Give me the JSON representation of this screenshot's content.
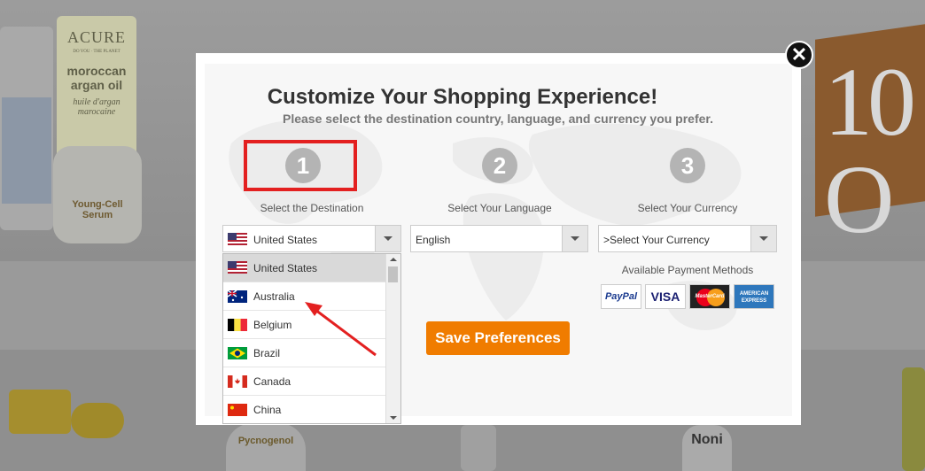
{
  "background": {
    "acure_brand": "ACURE",
    "acure_tagline": "DO YOU · THE PLANET",
    "acure_product": "moroccan argan oil",
    "acure_product_fr": "huile d'argan marocaine",
    "young_cell": "Young-Cell Serum",
    "pycnogenol": "Pycnogenol",
    "noni": "Noni",
    "promo_text": "10 O"
  },
  "modal": {
    "title": "Customize Your Shopping Experience!",
    "subtitle": "Please select the destination country, language, and currency you prefer.",
    "close_glyph": "✕",
    "steps": [
      {
        "number": "1",
        "label": "Select the Destination"
      },
      {
        "number": "2",
        "label": "Select Your Language"
      },
      {
        "number": "3",
        "label": "Select Your Currency"
      }
    ],
    "destination_select": {
      "value": "United States"
    },
    "language_select": {
      "value": "English"
    },
    "currency_select": {
      "value": ">Select Your Currency"
    },
    "country_options": [
      {
        "label": "United States",
        "flag": "us-flag-icon",
        "selected": true
      },
      {
        "label": "Australia",
        "flag": "australia-flag-icon"
      },
      {
        "label": "Belgium",
        "flag": "belgium-flag-icon"
      },
      {
        "label": "Brazil",
        "flag": "brazil-flag-icon"
      },
      {
        "label": "Canada",
        "flag": "canada-flag-icon"
      },
      {
        "label": "China",
        "flag": "china-flag-icon"
      }
    ],
    "payment": {
      "label": "Available Payment Methods",
      "methods": [
        "PayPal",
        "VISA",
        "MasterCard",
        "AMERICAN EXPRESS"
      ]
    },
    "save_button": "Save Preferences"
  },
  "colors": {
    "accent": "#f07c00",
    "highlight": "#e32020",
    "step_circle": "#b4b4b4"
  }
}
